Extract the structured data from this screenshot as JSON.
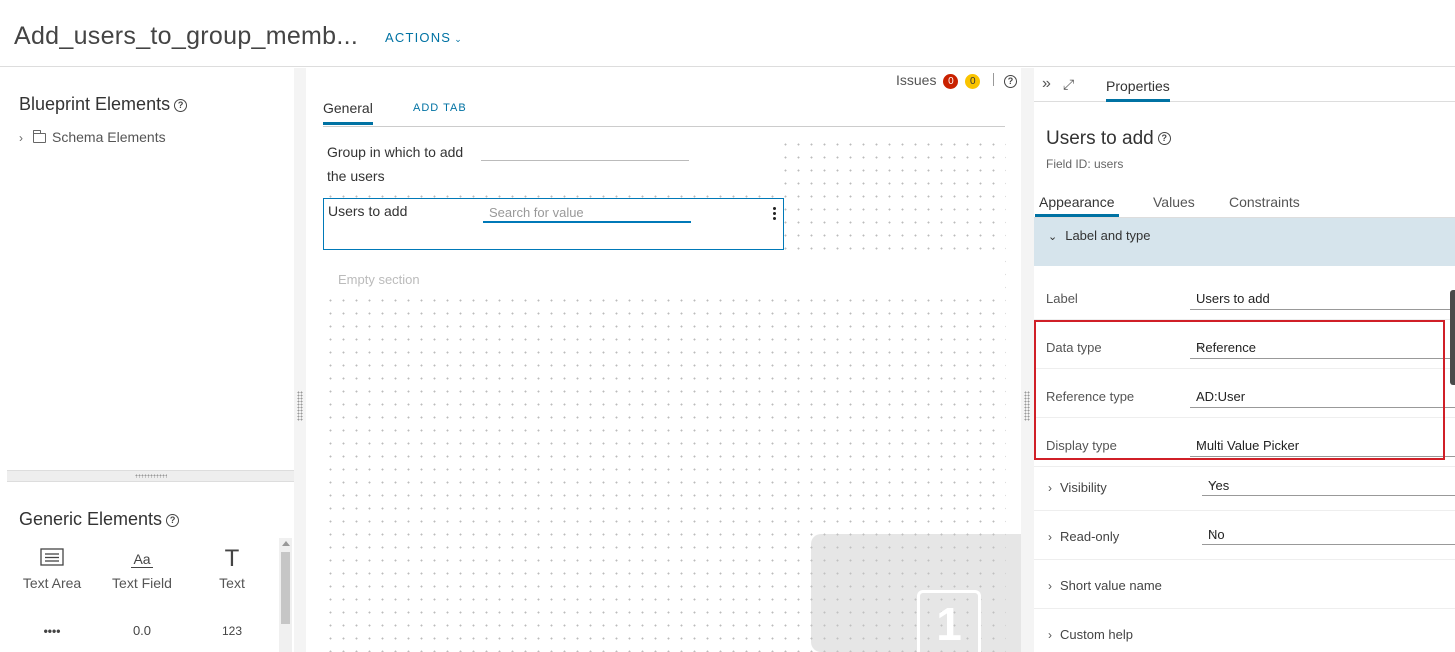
{
  "header": {
    "title": "Add_users_to_group_memb...",
    "actions_label": "ACTIONS"
  },
  "left_panel": {
    "blueprint_title": "Blueprint Elements",
    "tree": [
      {
        "label": "Schema Elements"
      }
    ],
    "generic_title": "Generic Elements",
    "generic_items": [
      {
        "icon": "text-area-icon",
        "label": "Text Area"
      },
      {
        "icon": "text-field-icon",
        "label": "Text Field",
        "glyph": "Aa"
      },
      {
        "icon": "text-icon",
        "label": "Text",
        "glyph": "T"
      },
      {
        "icon": "password-icon",
        "glyph": "••••"
      },
      {
        "icon": "decimal-icon",
        "glyph": "0.0"
      },
      {
        "icon": "integer-icon",
        "glyph": "123"
      }
    ]
  },
  "canvas": {
    "issues_label": "Issues",
    "issues_errors": "0",
    "issues_warnings": "0",
    "tabs": {
      "general": "General",
      "add_tab": "ADD TAB"
    },
    "fields": [
      {
        "label": "Group in which to add the users"
      },
      {
        "label": "Users to add",
        "placeholder": "Search for value"
      }
    ],
    "empty_section": "Empty section",
    "drop_number": "1"
  },
  "properties": {
    "tab": "Properties",
    "field_title": "Users to add",
    "field_id": "Field ID: users",
    "subtabs": [
      "Appearance",
      "Values",
      "Constraints"
    ],
    "section": "Label and type",
    "rows": [
      {
        "key": "Label",
        "value": "Users to add"
      },
      {
        "key": "Data type",
        "value": "Reference"
      },
      {
        "key": "Reference type",
        "value": "AD:User"
      },
      {
        "key": "Display type",
        "value": "Multi Value Picker"
      }
    ],
    "expandables": [
      {
        "key": "Visibility",
        "value": "Yes"
      },
      {
        "key": "Read-only",
        "value": "No"
      },
      {
        "key": "Short value name"
      },
      {
        "key": "Custom help"
      }
    ]
  },
  "colors": {
    "accent": "#0072a3",
    "highlight": "#d01f27",
    "section_bg": "#d6e4ec",
    "error": "#c92100",
    "warning": "#fac400"
  }
}
